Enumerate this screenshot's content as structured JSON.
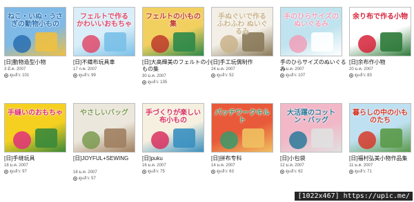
{
  "items": [
    {
      "cover_text": "ねこ・いぬ・うさぎの動物小もの",
      "title": "[日]動物造型小物",
      "date": "3 มี.ค. 2007",
      "views": "ดูแล้ว: 101",
      "colors": [
        "#7fb9e6",
        "#2a6fb0",
        "#f0c040"
      ]
    },
    {
      "cover_text": "フェルトで作る かわいいおもちゃ",
      "title": "[日]不織布玩具車",
      "date": "17 ก.พ. 2007",
      "views": "ดูแล้ว: 99",
      "colors": [
        "#d9eef8",
        "#e04a6a",
        "#7ac0e8"
      ]
    },
    {
      "cover_text": "フェルトの小もの集",
      "title": "[日]大高輝美のフェルトの小もの集",
      "date": "30 ม.ค. 2007",
      "views": "ดูแล้ว: 135",
      "colors": [
        "#f2d060",
        "#c0392b",
        "#2d8a4a"
      ]
    },
    {
      "cover_text": "手ぬぐいで作る ふわふわ ぬいぐるみ",
      "title": "[日]手工玩偶制作",
      "date": "24 ม.ค. 2007",
      "views": "ดูแล้ว: 52",
      "colors": [
        "#f3efe6",
        "#c9b38a",
        "#8a7a5a"
      ]
    },
    {
      "cover_text": "手のひらサイズのぬいぐるみ",
      "title": "手のひらサイズのぬいぐるみ",
      "date": "21 ม.ค. 2007",
      "views": "ดูแล้ว: 107",
      "colors": [
        "#bfe3ef",
        "#f0a0b8",
        "#ffffff"
      ]
    },
    {
      "cover_text": "余り布で作る小物",
      "title": "[日]余布作小物",
      "date": "20 ม.ค. 2007",
      "views": "ดูแล้ว: 83",
      "colors": [
        "#ffffff",
        "#d6223a",
        "#2e7a3a"
      ]
    },
    {
      "cover_text": "手縫いのおもちゃ",
      "title": "[日]手缝玩具",
      "date": "18 ม.ค. 2007",
      "views": "ดูแล้ว: 97",
      "colors": [
        "#f5d020",
        "#e0307a",
        "#3a8a3a"
      ]
    },
    {
      "cover_text": "やさしいバッグ",
      "title": "[日]JOYFUL+SEWING",
      "date": "16 ม.ค. 2007",
      "views": "ดูแล้ว: 57",
      "colors": [
        "#ece7dc",
        "#7a9a50",
        "#a08060"
      ]
    },
    {
      "cover_text": "手づくりが楽しい布小もの",
      "title": "[日]puku",
      "date": "16 ม.ค. 2007",
      "views": "ดูแล้ว: 75",
      "colors": [
        "#f6f0e0",
        "#d83060",
        "#3a90c0"
      ]
    },
    {
      "cover_text": "パッチワークキルト",
      "title": "[日]拼布专科",
      "date": "14 ม.ค. 2007",
      "views": "ดูแล้ว: 63",
      "colors": [
        "#e85a3a",
        "#3a9a6a",
        "#f0c060"
      ]
    },
    {
      "cover_text": "大活躍のコットン・バッグ",
      "title": "[日]小包袋",
      "date": "12 ม.ค. 2007",
      "views": "ดูแล้ว: 62",
      "colors": [
        "#f2b8c8",
        "#2a7a9a",
        "#e0e0e0"
      ]
    },
    {
      "cover_text": "暮らしの中の小ものたち",
      "title": "[日]福村弘美小物作品集",
      "date": "11 ม.ค. 2007",
      "views": "ดูแล้ว: 71",
      "colors": [
        "#bfe0f0",
        "#d63a2a",
        "#5a9a4a"
      ]
    }
  ],
  "watermark": "[1022x467] https://upic.me/"
}
